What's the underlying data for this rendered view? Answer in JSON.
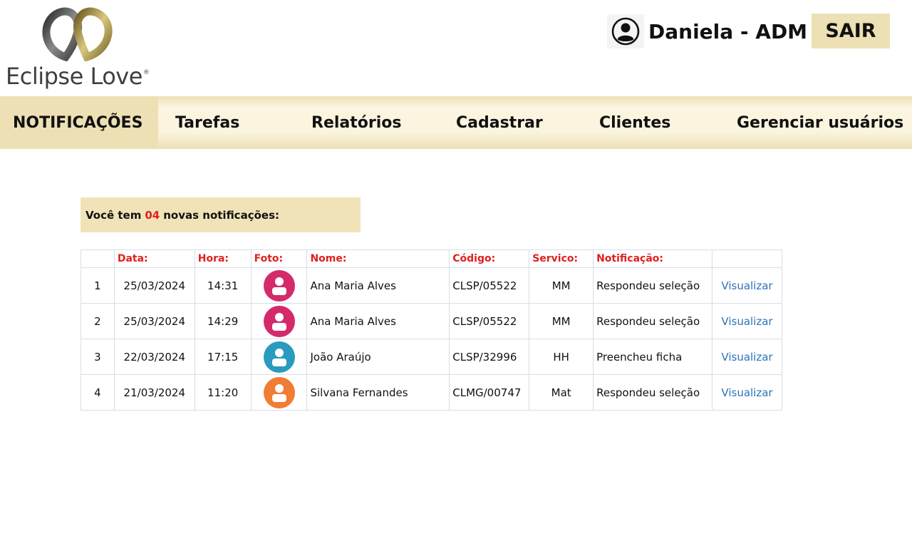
{
  "brand": {
    "name": "Eclipse Love",
    "mark": "®"
  },
  "header": {
    "user_name": "Daniela - ADM",
    "logout_label": "SAIR"
  },
  "nav": {
    "items": [
      {
        "label": "NOTIFICAÇÕES",
        "active": true
      },
      {
        "label": "Tarefas",
        "active": false
      },
      {
        "label": "Relatórios",
        "active": false
      },
      {
        "label": "Cadastrar",
        "active": false
      },
      {
        "label": "Clientes",
        "active": false
      },
      {
        "label": "Gerenciar usuários",
        "active": false
      }
    ]
  },
  "banner": {
    "prefix": "Você tem",
    "count": "04",
    "suffix": "novas notificações:"
  },
  "table": {
    "columns": [
      "",
      "Data:",
      "Hora:",
      "Foto:",
      "Nome:",
      "Código:",
      "Servico:",
      "Notificação:",
      ""
    ],
    "rows": [
      {
        "num": "1",
        "date": "25/03/2024",
        "time": "14:31",
        "avatar_color": "#d42a6c",
        "name": "Ana Maria Alves",
        "code": "CLSP/05522",
        "service": "MM",
        "notification": "Respondeu seleção",
        "action": "Visualizar"
      },
      {
        "num": "2",
        "date": "25/03/2024",
        "time": "14:29",
        "avatar_color": "#d42a6c",
        "name": "Ana Maria Alves",
        "code": "CLSP/05522",
        "service": "MM",
        "notification": "Respondeu seleção",
        "action": "Visualizar"
      },
      {
        "num": "3",
        "date": "22/03/2024",
        "time": "17:15",
        "avatar_color": "#2a9bbf",
        "name": "João Araújo",
        "code": "CLSP/32996",
        "service": "HH",
        "notification": "Preencheu ficha",
        "action": "Visualizar"
      },
      {
        "num": "4",
        "date": "21/03/2024",
        "time": "11:20",
        "avatar_color": "#f07d33",
        "name": "Silvana Fernandes",
        "code": "CLMG/00747",
        "service": "Mat",
        "notification": "Respondeu seleção",
        "action": "Visualizar"
      }
    ]
  },
  "colors": {
    "accent": "#ede0b4",
    "header_red": "#e0201f",
    "link_blue": "#2b74b8"
  },
  "icons": {
    "user": "user-circle-icon",
    "avatar": "person-avatar-icon"
  }
}
